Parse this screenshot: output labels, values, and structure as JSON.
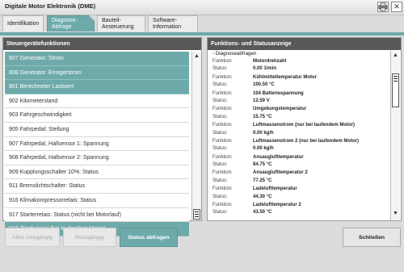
{
  "window": {
    "title": "Digitale Motor Elektronik (DME)"
  },
  "tabs": [
    {
      "line1": "Identifikation",
      "line2": ""
    },
    {
      "line1": "Diagnose-",
      "line2": "Abfrage"
    },
    {
      "line1": "Bauteil-",
      "line2": "Ansteuerung"
    },
    {
      "line1": "Software-",
      "line2": "Information"
    }
  ],
  "left_panel": {
    "header": "Steuergerätefunktionen",
    "items": [
      {
        "label": "807 Generator: Strom",
        "selected": true
      },
      {
        "label": "808 Generator: Erregerstrom",
        "selected": true
      },
      {
        "label": "901 Berechneter Lastwert",
        "selected": true
      },
      {
        "label": "902 Kilometerstand",
        "selected": false
      },
      {
        "label": "903 Fahrgeschwindigkeit",
        "selected": false
      },
      {
        "label": "905 Fahrpedal: Stellung",
        "selected": false
      },
      {
        "label": "907 Fahrpedal, Hallsensor 1: Spannung",
        "selected": false
      },
      {
        "label": "908 Fahrpedal, Hallsensor 2: Spannung",
        "selected": false
      },
      {
        "label": "909 Kupplungsschalter 10%: Status",
        "selected": false
      },
      {
        "label": "911 Bremslichtschalter: Status",
        "selected": false
      },
      {
        "label": "916 Klimakompressorrelais: Status",
        "selected": false
      },
      {
        "label": "917 Starterrelais: Status (nicht bei Motorlauf)",
        "selected": false
      },
      {
        "label": "918 Zündwinkel (bei laufendem Motor)",
        "selected": true
      }
    ]
  },
  "right_panel": {
    "header": "Funktions- und Statusanzeige",
    "section": "- Diagnoseabfragen",
    "function_label": "Funktion:",
    "status_label": "Status:",
    "entries": [
      {
        "function": "Motordrehzahl",
        "status": "0.00  1/min"
      },
      {
        "function": "Kühlmitteltemperatur Motor",
        "status": "100.50  °C"
      },
      {
        "function": "104 Batteriespannung",
        "status": "12.59  V"
      },
      {
        "function": "Umgebungstemperatur",
        "status": "15.75  °C"
      },
      {
        "function": "Luftmassenstrom  (nur bei laufendem Motor)",
        "status": "0.00  kg/h"
      },
      {
        "function": "Luftmassenstrom 2 (nur bei laufendem Motor)",
        "status": "0.00  kg/h"
      },
      {
        "function": "Ansauglufttemperatur",
        "status": "84.75  °C"
      },
      {
        "function": "Ansauglufttemperatur 2",
        "status": "77.25  °C"
      },
      {
        "function": "Ladelufttemperatur",
        "status": "44.30  °C"
      },
      {
        "function": "Ladelufttemperatur 2",
        "status": "43.50  °C"
      }
    ]
  },
  "buttons": {
    "undo_all": "Alles rückgängig",
    "undo": "Rückgängig",
    "query_status": "Status abfragen",
    "close": "Schließen"
  },
  "icons": {
    "print": "printer-icon",
    "close": "close-icon"
  },
  "colors": {
    "accent": "#6eaaaa",
    "header_dark": "#585858",
    "background": "#dcdcdc"
  }
}
